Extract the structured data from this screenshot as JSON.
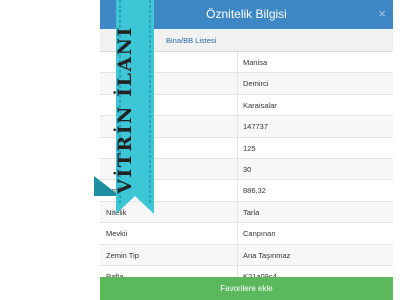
{
  "dialog": {
    "title": "Öznitelik Bilgisi",
    "close_label": "×",
    "tab_label": "Bina/BB Listesi",
    "rows": [
      {
        "label": "",
        "value": "Manisa"
      },
      {
        "label": "",
        "value": "Demirci"
      },
      {
        "label": "",
        "value": "Karaisalar"
      },
      {
        "label": "",
        "value": "147737"
      },
      {
        "label": "",
        "value": "125"
      },
      {
        "label": "",
        "value": "30"
      },
      {
        "label": "lam",
        "value": "886,32"
      },
      {
        "label": "Nitelik",
        "value": "Tarla"
      },
      {
        "label": "Mevkii",
        "value": "Canpınan"
      },
      {
        "label": "Zemin Tip",
        "value": "Ana Taşınmaz"
      },
      {
        "label": "Pafta",
        "value": "K21a09c4"
      }
    ],
    "favorite_button": "Favorilere ekle"
  },
  "ribbon": {
    "text": "VİTRİN İLANI",
    "color": "#3cc6d6"
  },
  "colors": {
    "header": "#3d88c4",
    "button": "#5cb85c",
    "link": "#2a6aa3"
  }
}
